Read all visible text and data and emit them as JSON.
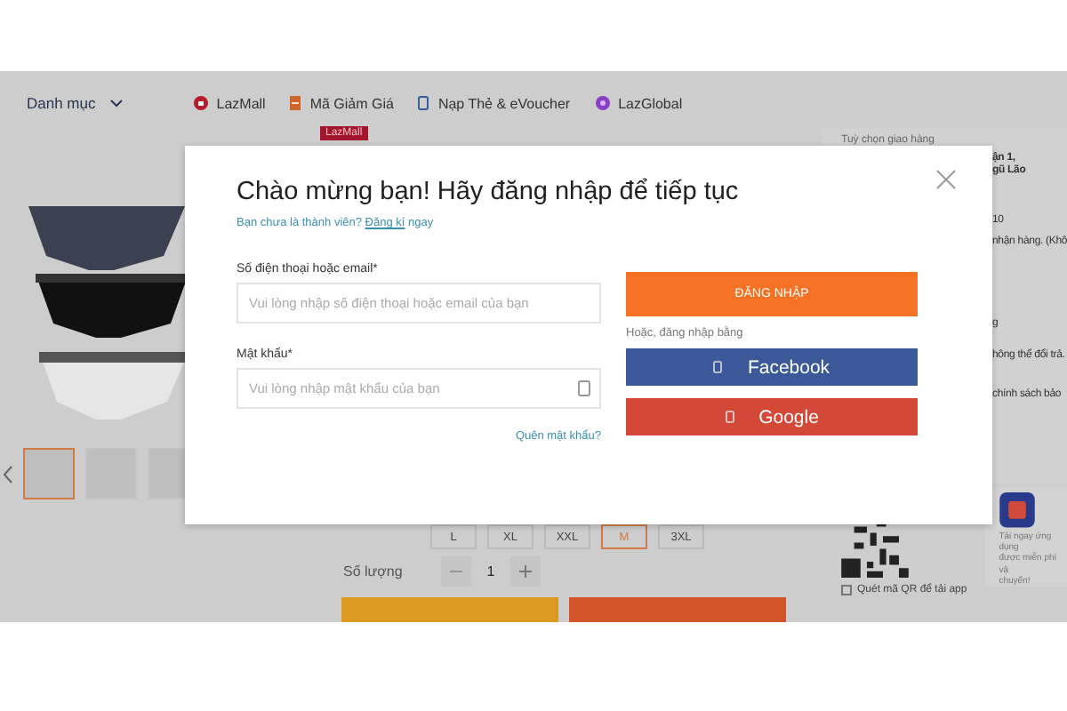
{
  "nav": {
    "menu_label": "Danh mục",
    "links": [
      {
        "kind": "mall",
        "label": "LazMall"
      },
      {
        "kind": "voucher",
        "label": "Mã Giảm Giá"
      },
      {
        "kind": "topup",
        "label": "Nạp Thẻ & eVoucher"
      },
      {
        "kind": "global",
        "label": "LazGlobal"
      }
    ]
  },
  "product": {
    "badge": "LazMall",
    "thumbnails": [
      {
        "selected": true
      },
      {
        "selected": false
      },
      {
        "selected": false
      }
    ],
    "sizes": [
      {
        "label": "L",
        "selected": false
      },
      {
        "label": "XL",
        "selected": false
      },
      {
        "label": "XXL",
        "selected": false
      },
      {
        "label": "M",
        "selected": true
      },
      {
        "label": "3XL",
        "selected": false
      }
    ],
    "quantity_label": "Số lượng",
    "quantity": "1"
  },
  "delivery": {
    "title": "Tuỳ chọn giao hàng",
    "lines": [
      "ận 1,",
      "gũ Lão",
      "10",
      "nhận hàng. (Khô",
      "g",
      "hông thể đổi trả.",
      "chính sách bảo"
    ]
  },
  "app_promo": {
    "lines": [
      "Tải ngay ứng dụng",
      "được miễn phí vậ",
      "chuyển!"
    ],
    "qr_label": "Quét mã QR để tải app",
    "checked": false
  },
  "login_modal": {
    "title": "Chào mừng bạn! Hãy đăng nhập để tiếp tục",
    "prompt": "Bạn chưa là thành viên?",
    "signup_link": "Đăng kí",
    "prompt_end": "ngay",
    "fields": [
      {
        "kind": "text",
        "label": "Số điện thoại hoặc email*",
        "placeholder": "Vui lòng nhập số điện thoại hoặc email của bạn"
      },
      {
        "kind": "password",
        "label": "Mật khẩu*",
        "placeholder": "Vui lòng nhập mật khẩu của bạn"
      }
    ],
    "forgot_link": "Quên mật khẩu?",
    "submit": "ĐĂNG NHẬP",
    "alt_label": "Hoặc, đăng nhập bằng",
    "social": [
      {
        "label": "Facebook",
        "color": "#3b5998"
      },
      {
        "label": "Google",
        "color": "#d34836"
      }
    ]
  }
}
